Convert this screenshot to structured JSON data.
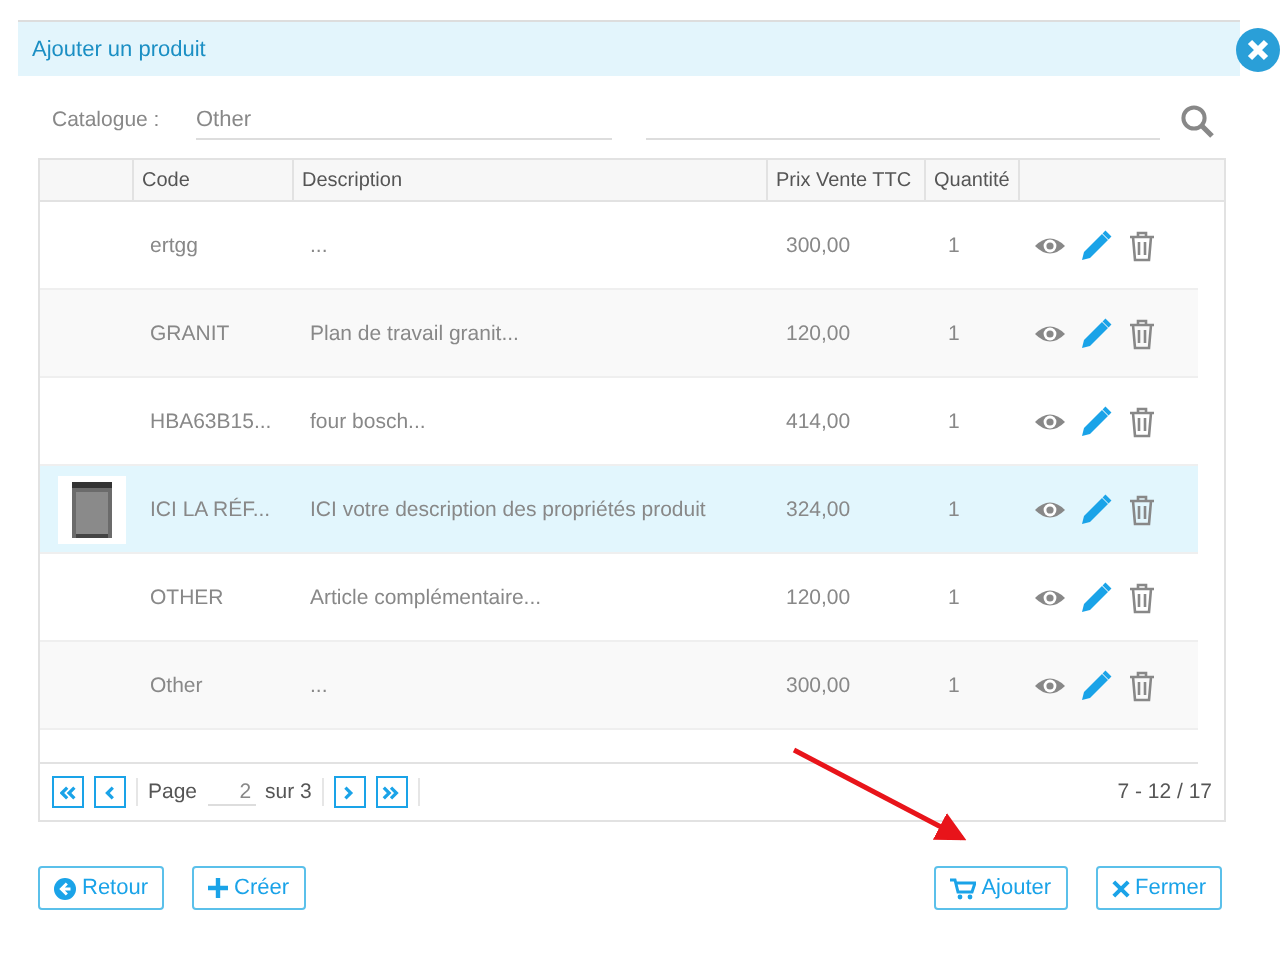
{
  "dialog": {
    "title": "Ajouter un produit"
  },
  "filter": {
    "label": "Catalogue :",
    "catalogue_value": "Other"
  },
  "table": {
    "columns": [
      "Code",
      "Description",
      "Prix Vente TTC",
      "Quantité"
    ],
    "rows": [
      {
        "code": "ertgg",
        "description": "...",
        "price": "300,00",
        "quantity": "1",
        "selected": false
      },
      {
        "code": "GRANIT",
        "description": "Plan de travail granit...",
        "price": "120,00",
        "quantity": "1",
        "selected": false
      },
      {
        "code": "HBA63B15...",
        "description": "four bosch...",
        "price": "414,00",
        "quantity": "1",
        "selected": false
      },
      {
        "code": "ICI LA RÉF...",
        "description": "ICI votre description des propriétés produit",
        "price": "324,00",
        "quantity": "1",
        "selected": true
      },
      {
        "code": "OTHER",
        "description": "Article complémentaire...",
        "price": "120,00",
        "quantity": "1",
        "selected": false
      },
      {
        "code": "Other",
        "description": "...",
        "price": "300,00",
        "quantity": "1",
        "selected": false
      }
    ]
  },
  "pager": {
    "page_label": "Page",
    "page": "2",
    "of_label": "sur 3",
    "range": "7 - 12 / 17"
  },
  "buttons": [
    {
      "kind": "back",
      "label": "Retour"
    },
    {
      "kind": "create",
      "label": "Créer"
    },
    {
      "kind": "add",
      "label": "Ajouter"
    },
    {
      "kind": "close",
      "label": "Fermer"
    }
  ]
}
